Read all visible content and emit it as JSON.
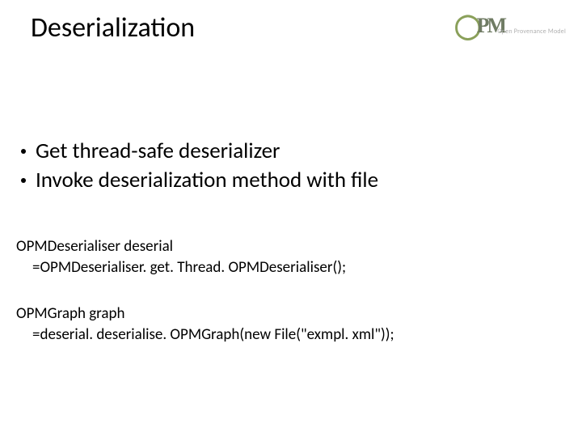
{
  "title": "Deserialization",
  "logo": {
    "letters": "PM",
    "subtitle": "Open Provenance Model"
  },
  "bullets": [
    "Get thread-safe deserializer",
    "Invoke deserialization method with file"
  ],
  "code": {
    "line1": "OPMDeserialiser deserial",
    "line2": "=OPMDeserialiser. get. Thread. OPMDeserialiser();",
    "line3": "OPMGraph graph",
    "line4": "=deserial. deserialise. OPMGraph(new File(\"exmpl. xml\"));"
  }
}
